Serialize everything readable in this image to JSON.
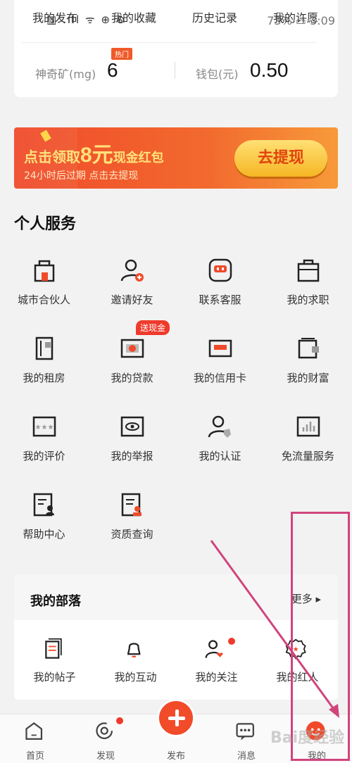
{
  "status": {
    "left": "▥ .ıll ᯤ ⊕ ⊝",
    "right": "73% ▭ 3:09"
  },
  "quick_links": [
    "我的发布",
    "我的收藏",
    "历史记录",
    "我的许愿"
  ],
  "stats": {
    "mine_label": "神奇矿(mg)",
    "mine_value": "6",
    "hot_badge": "热门",
    "wallet_label": "钱包(元)",
    "wallet_value": "0.50"
  },
  "banner": {
    "prefix": "点击领取",
    "amount": "8元",
    "suffix": "现金红包",
    "sub": "24小时后过期   点击去提现",
    "button": "去提现"
  },
  "personal_services": {
    "title": "个人服务",
    "badge": "送现金",
    "items": [
      {
        "label": "城市合伙人",
        "icon": "shop-icon"
      },
      {
        "label": "邀请好友",
        "icon": "invite-user-icon"
      },
      {
        "label": "联系客服",
        "icon": "customer-service-icon"
      },
      {
        "label": "我的求职",
        "icon": "briefcase-icon"
      },
      {
        "label": "我的租房",
        "icon": "building-icon"
      },
      {
        "label": "我的贷款",
        "icon": "money-icon"
      },
      {
        "label": "我的信用卡",
        "icon": "credit-card-icon"
      },
      {
        "label": "我的财富",
        "icon": "wallet-icon"
      },
      {
        "label": "我的评价",
        "icon": "rating-icon"
      },
      {
        "label": "我的举报",
        "icon": "eye-icon"
      },
      {
        "label": "我的认证",
        "icon": "verified-user-icon"
      },
      {
        "label": "免流量服务",
        "icon": "data-chart-icon"
      },
      {
        "label": "帮助中心",
        "icon": "help-doc-icon"
      },
      {
        "label": "资质查询",
        "icon": "certificate-icon"
      }
    ]
  },
  "tribe": {
    "title": "我的部落",
    "more": "更多 ▸",
    "items": [
      {
        "label": "我的帖子",
        "icon": "posts-icon"
      },
      {
        "label": "我的互动",
        "icon": "bell-icon"
      },
      {
        "label": "我的关注",
        "icon": "follow-icon"
      },
      {
        "label": "我的红人",
        "icon": "badge-icon"
      }
    ]
  },
  "tabbar": {
    "items": [
      {
        "label": "首页",
        "icon": "home-icon"
      },
      {
        "label": "发现",
        "icon": "discover-icon"
      },
      {
        "label": "发布",
        "icon": "publish-plus-icon"
      },
      {
        "label": "消息",
        "icon": "message-icon"
      },
      {
        "label": "我的",
        "icon": "me-face-icon"
      }
    ]
  },
  "colors": {
    "accent": "#f24b2a",
    "annotation": "#d0447c"
  },
  "watermark": "Bai度经验"
}
